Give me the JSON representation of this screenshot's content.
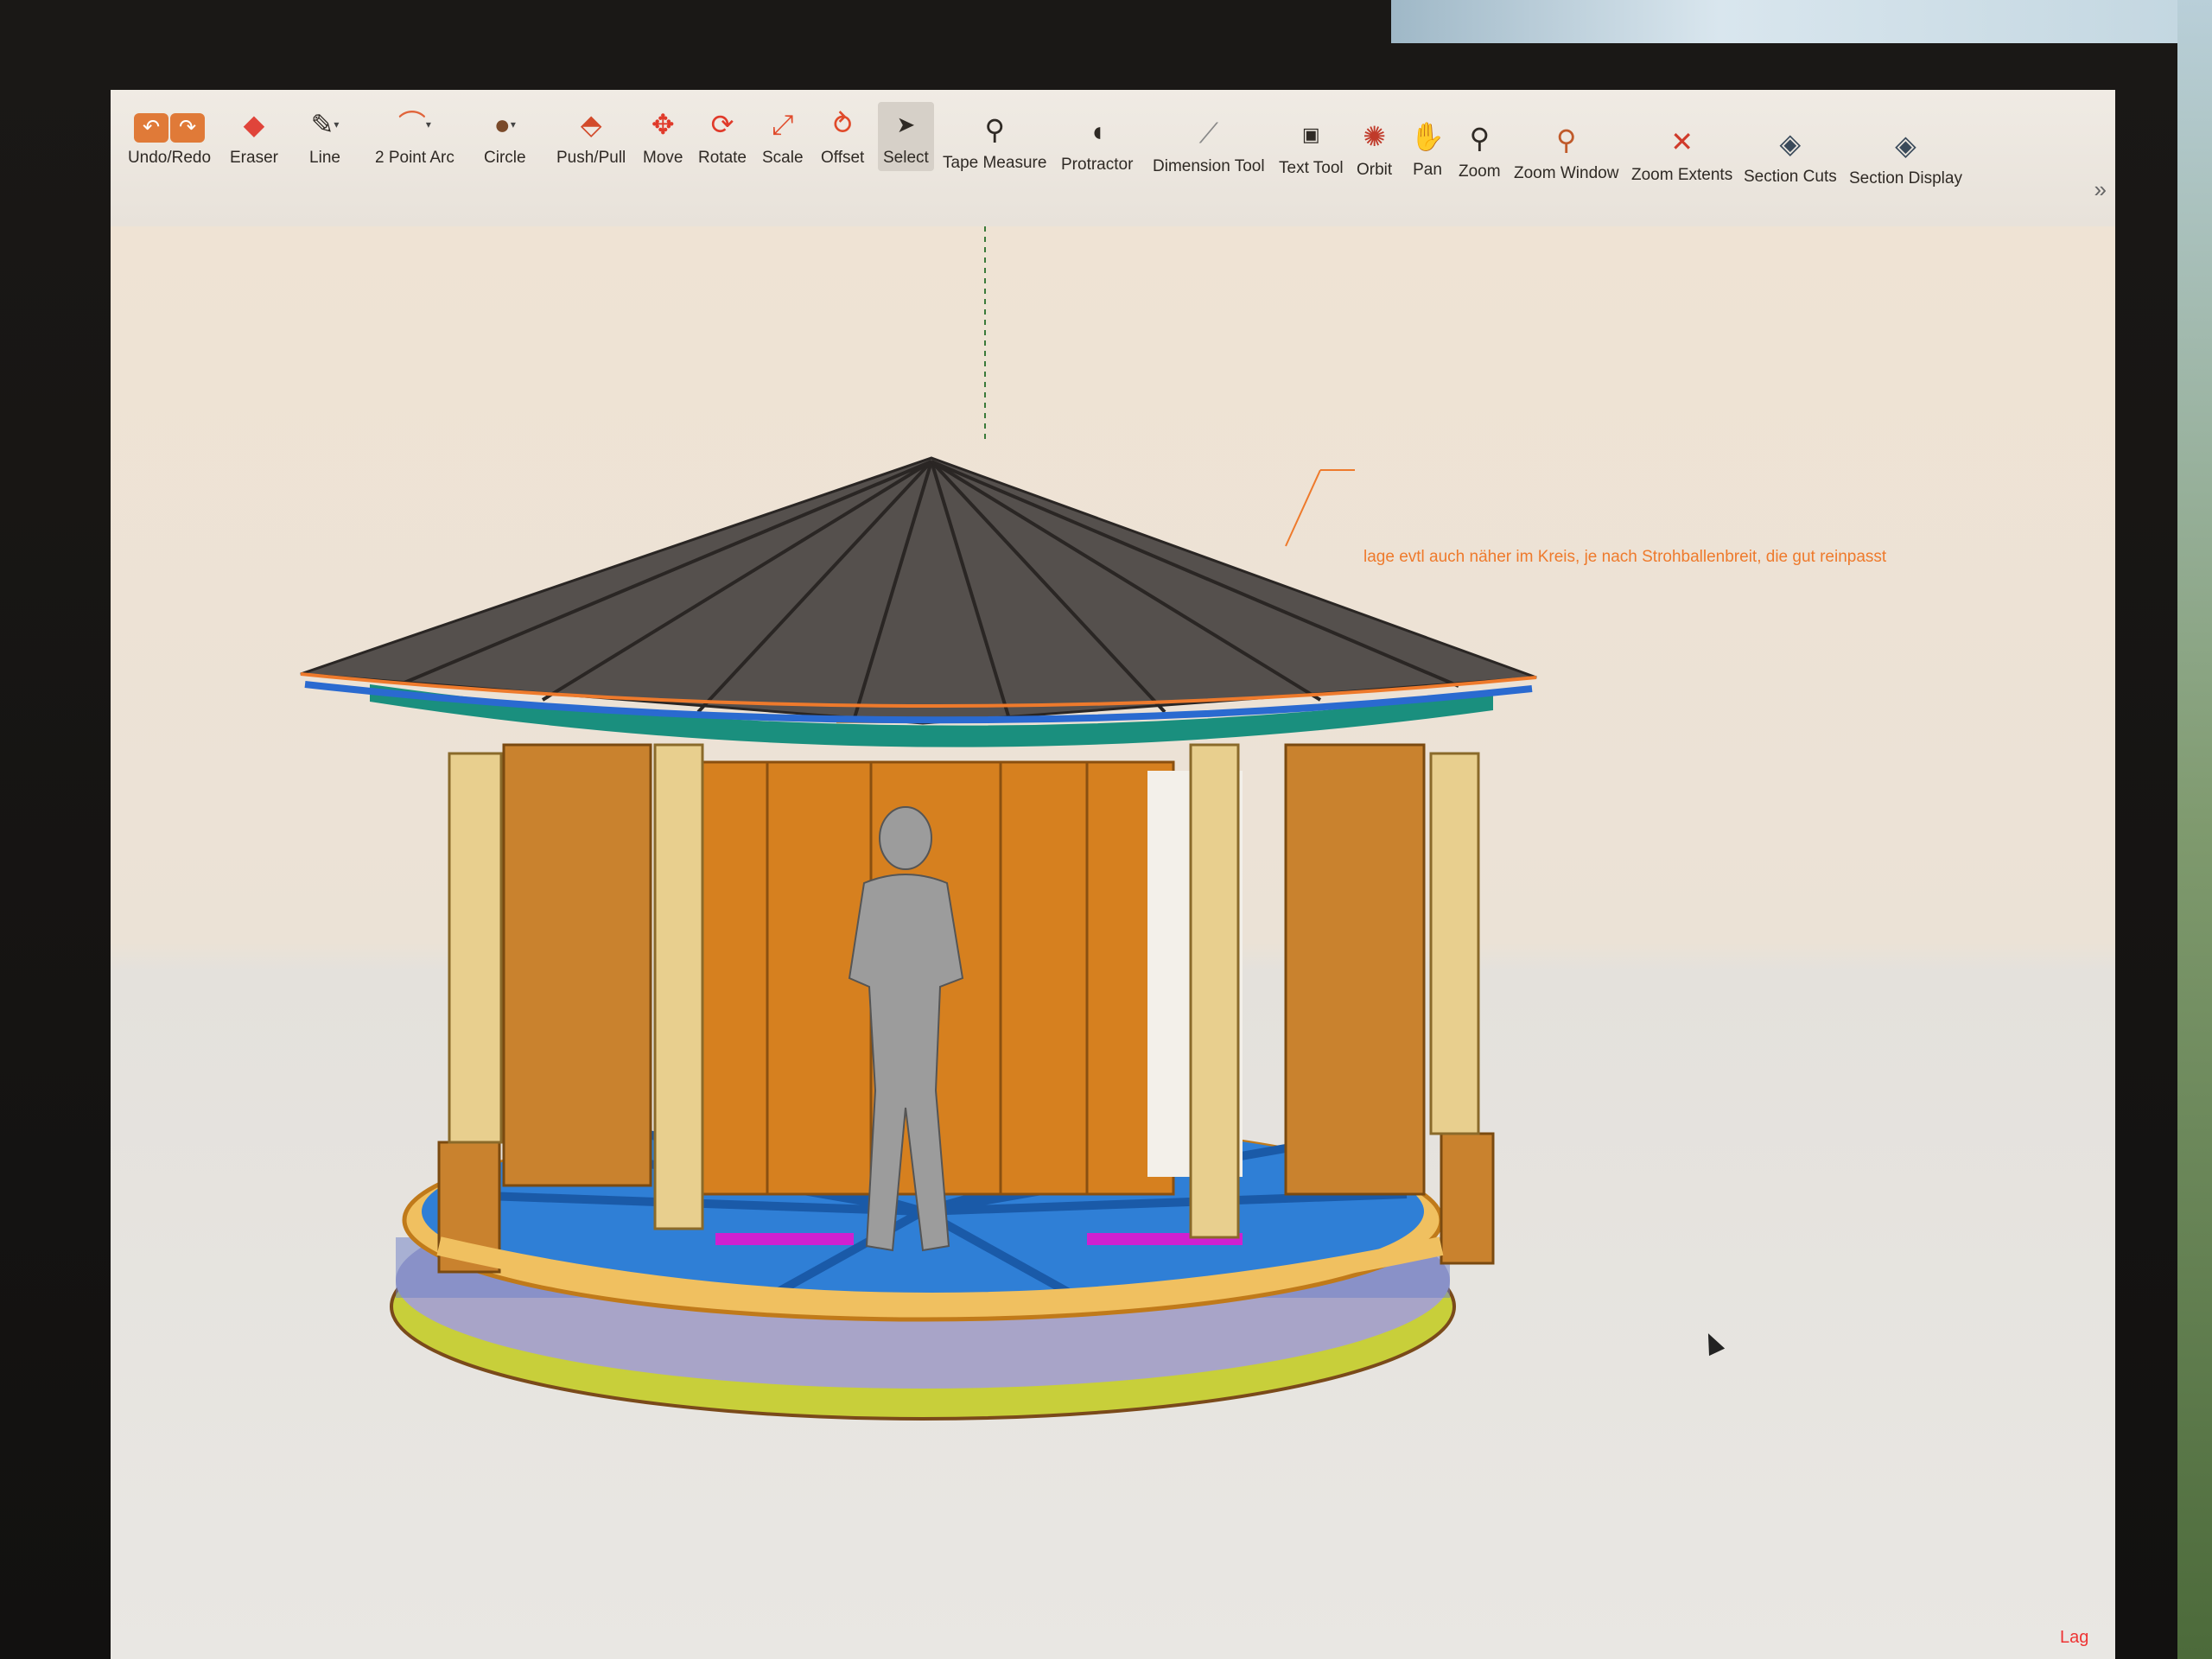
{
  "toolbar": {
    "tools": [
      {
        "id": "undo-redo",
        "label": "Undo/Redo",
        "icon": "undo-redo-icon"
      },
      {
        "id": "eraser",
        "label": "Eraser",
        "icon": "eraser-icon"
      },
      {
        "id": "line",
        "label": "Line",
        "icon": "pencil-icon"
      },
      {
        "id": "arc",
        "label": "2 Point Arc",
        "icon": "arc-icon"
      },
      {
        "id": "circle",
        "label": "Circle",
        "icon": "circle-icon"
      },
      {
        "id": "pushpull",
        "label": "Push/Pull",
        "icon": "push-pull-icon"
      },
      {
        "id": "move",
        "label": "Move",
        "icon": "move-icon"
      },
      {
        "id": "rotate",
        "label": "Rotate",
        "icon": "rotate-icon"
      },
      {
        "id": "scale",
        "label": "Scale",
        "icon": "scale-icon"
      },
      {
        "id": "offset",
        "label": "Offset",
        "icon": "offset-icon"
      },
      {
        "id": "select",
        "label": "Select",
        "icon": "cursor-icon"
      },
      {
        "id": "tape",
        "label": "Tape Measure",
        "icon": "tape-measure-icon"
      },
      {
        "id": "protractor",
        "label": "Protractor",
        "icon": "protractor-icon"
      },
      {
        "id": "dimension",
        "label": "Dimension Tool",
        "icon": "dimension-icon"
      },
      {
        "id": "text",
        "label": "Text Tool",
        "icon": "text-icon"
      },
      {
        "id": "orbit",
        "label": "Orbit",
        "icon": "orbit-icon"
      },
      {
        "id": "pan",
        "label": "Pan",
        "icon": "hand-icon"
      },
      {
        "id": "zoom",
        "label": "Zoom",
        "icon": "magnifier-icon"
      },
      {
        "id": "zoomwindow",
        "label": "Zoom Window",
        "icon": "zoom-window-icon"
      },
      {
        "id": "zoomextents",
        "label": "Zoom Extents",
        "icon": "zoom-extents-icon"
      },
      {
        "id": "sectioncuts",
        "label": "Section Cuts",
        "icon": "section-cuts-icon"
      },
      {
        "id": "sectiondisplay",
        "label": "Section Display",
        "icon": "section-display-icon"
      }
    ],
    "active_tool": "Select",
    "overflow_label": "»"
  },
  "viewport": {
    "annotation_main": "lage evtl auch näher im Kreis, je nach Strohballenbreit, die gut reinpasst",
    "annotation_faint": "",
    "annotation_edge": "Lag"
  },
  "colors": {
    "roof": "#55504d",
    "fascia": "#1a8f7e",
    "wall_wood": "#c9822e",
    "post": "#e8cf8e",
    "floor_blue": "#2f7fd6",
    "base_yellow": "#c8cf3a",
    "annotation": "#ee7a2c",
    "accent_magenta": "#d020d0"
  }
}
